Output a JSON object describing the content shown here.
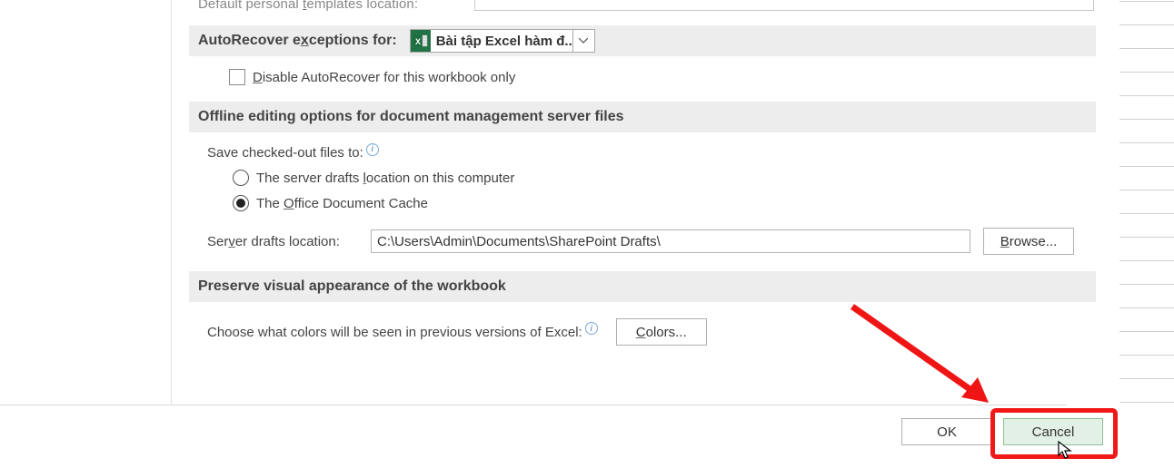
{
  "top": {
    "templates_label_html": "Default personal&nbsp;templates location:"
  },
  "autorecover_exceptions": {
    "header_pre": "AutoRecover e",
    "header_u": "x",
    "header_post": "ceptions for:",
    "workbook": "Bài tập Excel hàm đ...",
    "disable_pre": "",
    "disable_u": "D",
    "disable_post": "isable AutoRecover for this workbook only"
  },
  "offline": {
    "header": "Offline editing options for document management server files",
    "save_checked_out": "Save checked-out files to:",
    "radio1_pre": "The server drafts ",
    "radio1_u": "l",
    "radio1_post": "ocation on this computer",
    "radio2_pre": "The ",
    "radio2_u": "O",
    "radio2_post": "ffice Document Cache",
    "drafts_label_pre": "Ser",
    "drafts_label_u": "v",
    "drafts_label_post": "er drafts location:",
    "drafts_path": "C:\\Users\\Admin\\Documents\\SharePoint Drafts\\",
    "browse_u": "B",
    "browse_post": "rowse..."
  },
  "preserve": {
    "header": "Preserve visual appearance of the workbook",
    "colors_prompt": "Choose what colors will be seen in previous versions of Excel:",
    "colors_btn_u": "C",
    "colors_btn_post": "olors..."
  },
  "buttons": {
    "ok": "OK",
    "cancel": "Cancel"
  }
}
